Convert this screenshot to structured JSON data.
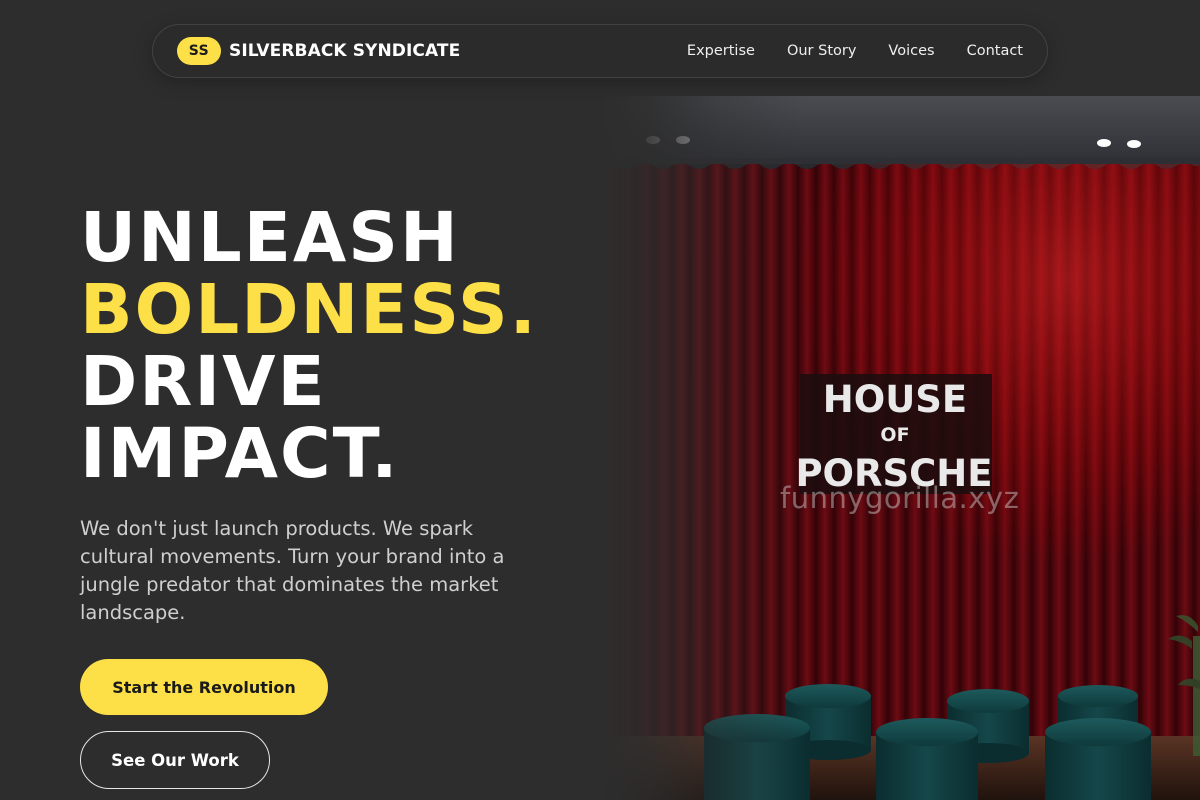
{
  "header": {
    "logo_badge": "SS",
    "brand_name": "SILVERBACK SYNDICATE",
    "nav": [
      {
        "label": "Expertise"
      },
      {
        "label": "Our Story"
      },
      {
        "label": "Voices"
      },
      {
        "label": "Contact"
      }
    ]
  },
  "hero": {
    "headline": {
      "line1": "UNLEASH",
      "line2": "BOLDNESS.",
      "line3": "DRIVE",
      "line4": "IMPACT."
    },
    "description": "We don't just launch products. We spark cultural movements. Turn your brand into a jungle predator that dominates the market landscape.",
    "primary_cta": "Start the Revolution",
    "secondary_cta": "See Our Work"
  },
  "image": {
    "sign": {
      "line1": "HOUSE",
      "line2": "OF",
      "line3": "PORSCHE"
    },
    "watermark": "funnygorilla.xyz"
  },
  "colors": {
    "background": "#2d2d2d",
    "accent": "#fde047",
    "text": "#ffffff",
    "muted_text": "#cfcfcf"
  }
}
